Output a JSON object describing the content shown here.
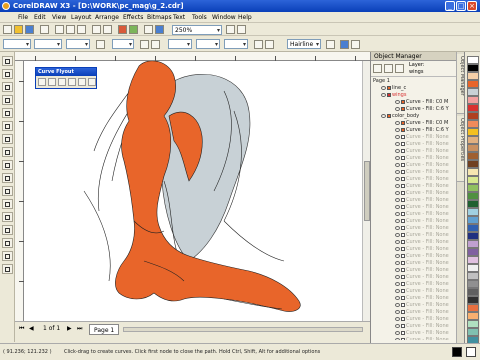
{
  "window": {
    "title": "CorelDRAW X3 - [D:\\WORK\\pc_mag\\g_2.cdr]",
    "buttons": [
      "_",
      "□",
      "×"
    ]
  },
  "menu": [
    "File",
    "Edit",
    "View",
    "Layout",
    "Arrange",
    "Effects",
    "Bitmaps",
    "Text",
    "Tools",
    "Window",
    "Help"
  ],
  "toolbar": {
    "zoom": "250%"
  },
  "propbar": {
    "outline_width": "Hairline"
  },
  "flyout": {
    "title": "Curve Flyout"
  },
  "object_manager": {
    "title": "Object Manager",
    "layer_label": "Layer:",
    "layer_name": "wings",
    "rows": [
      {
        "text": "Page 1",
        "state": "normal"
      },
      {
        "text": "line_c",
        "state": "normal"
      },
      {
        "text": "wings",
        "state": "accent"
      },
      {
        "text": "Curve - Fill: C0 M",
        "state": "normal"
      },
      {
        "text": "Curve - Fill: C:6 Y",
        "state": "normal"
      },
      {
        "text": "color_body",
        "state": "normal"
      },
      {
        "text": "Curve - Fill: C0 M",
        "state": "normal"
      },
      {
        "text": "Curve - Fill: C:6 Y",
        "state": "normal"
      },
      {
        "text": "Curve - Fill: None",
        "state": "dim"
      },
      {
        "text": "Curve - Fill: None",
        "state": "dim"
      },
      {
        "text": "Curve - Fill: None",
        "state": "dim"
      },
      {
        "text": "Curve - Fill: None",
        "state": "dim"
      },
      {
        "text": "Curve - Fill: None",
        "state": "dim"
      },
      {
        "text": "Curve - Fill: None",
        "state": "dim"
      },
      {
        "text": "Curve - Fill: None",
        "state": "dim"
      },
      {
        "text": "Curve - Fill: None",
        "state": "dim"
      },
      {
        "text": "Curve - Fill: None",
        "state": "dim"
      },
      {
        "text": "Curve - Fill: None",
        "state": "dim"
      },
      {
        "text": "Curve - Fill: None",
        "state": "dim"
      },
      {
        "text": "Curve - Fill: None",
        "state": "dim"
      },
      {
        "text": "Curve - Fill: None",
        "state": "dim"
      },
      {
        "text": "Curve - Fill: None",
        "state": "dim"
      },
      {
        "text": "Curve - Fill: None",
        "state": "dim"
      },
      {
        "text": "Curve - Fill: None",
        "state": "dim"
      },
      {
        "text": "Curve - Fill: None",
        "state": "dim"
      },
      {
        "text": "Curve - Fill: None",
        "state": "dim"
      },
      {
        "text": "Curve - Fill: None",
        "state": "dim"
      },
      {
        "text": "Curve - Fill: None",
        "state": "dim"
      },
      {
        "text": "Curve - Fill: None",
        "state": "dim"
      },
      {
        "text": "Curve - Fill: None",
        "state": "dim"
      },
      {
        "text": "Curve - Fill: None",
        "state": "dim"
      },
      {
        "text": "Curve - Fill: None",
        "state": "dim"
      },
      {
        "text": "Curve - Fill: None",
        "state": "dim"
      },
      {
        "text": "Curve - Fill: None",
        "state": "dim"
      },
      {
        "text": "Curve - Fill: None",
        "state": "dim"
      },
      {
        "text": "Curve - Fill: None",
        "state": "dim"
      },
      {
        "text": "Curve - Fill: None",
        "state": "dim"
      },
      {
        "text": "Curve - Fill: None",
        "state": "dim"
      }
    ]
  },
  "docker_tabs": [
    "Object Manager",
    "Object Properties"
  ],
  "pagebar": {
    "counter": "1 of 1",
    "tab": "Page 1"
  },
  "status": {
    "coords": "( 91.236; 121.232 )",
    "hint": "Click-drag to create curves. Click first node to close the path. Hold Ctrl, Shift, Alt for additional options"
  },
  "colors": {
    "figure_orange": "#e8652a",
    "wing_gray": "#c8d1d6",
    "title_blue": "#0a3fb8",
    "palette": [
      "#ffffff",
      "#000000",
      "#f5d0a9",
      "#e8652a",
      "#c8d1d6",
      "#f2a0a0",
      "#d83030",
      "#b04020",
      "#f08a5a",
      "#f4c020",
      "#e0b080",
      "#c89060",
      "#a06030",
      "#704020",
      "#f6e6b0",
      "#d8e890",
      "#90c060",
      "#509040",
      "#206030",
      "#a0d0e0",
      "#60a0d0",
      "#3060b0",
      "#203080",
      "#c0a0d0",
      "#8060a0",
      "#e0c0e0",
      "#f0f0f0",
      "#c0c0c0",
      "#909090",
      "#606060",
      "#303030",
      "#e87040",
      "#f8b070",
      "#b0e0c0",
      "#80c0b0",
      "#4090a0"
    ]
  }
}
